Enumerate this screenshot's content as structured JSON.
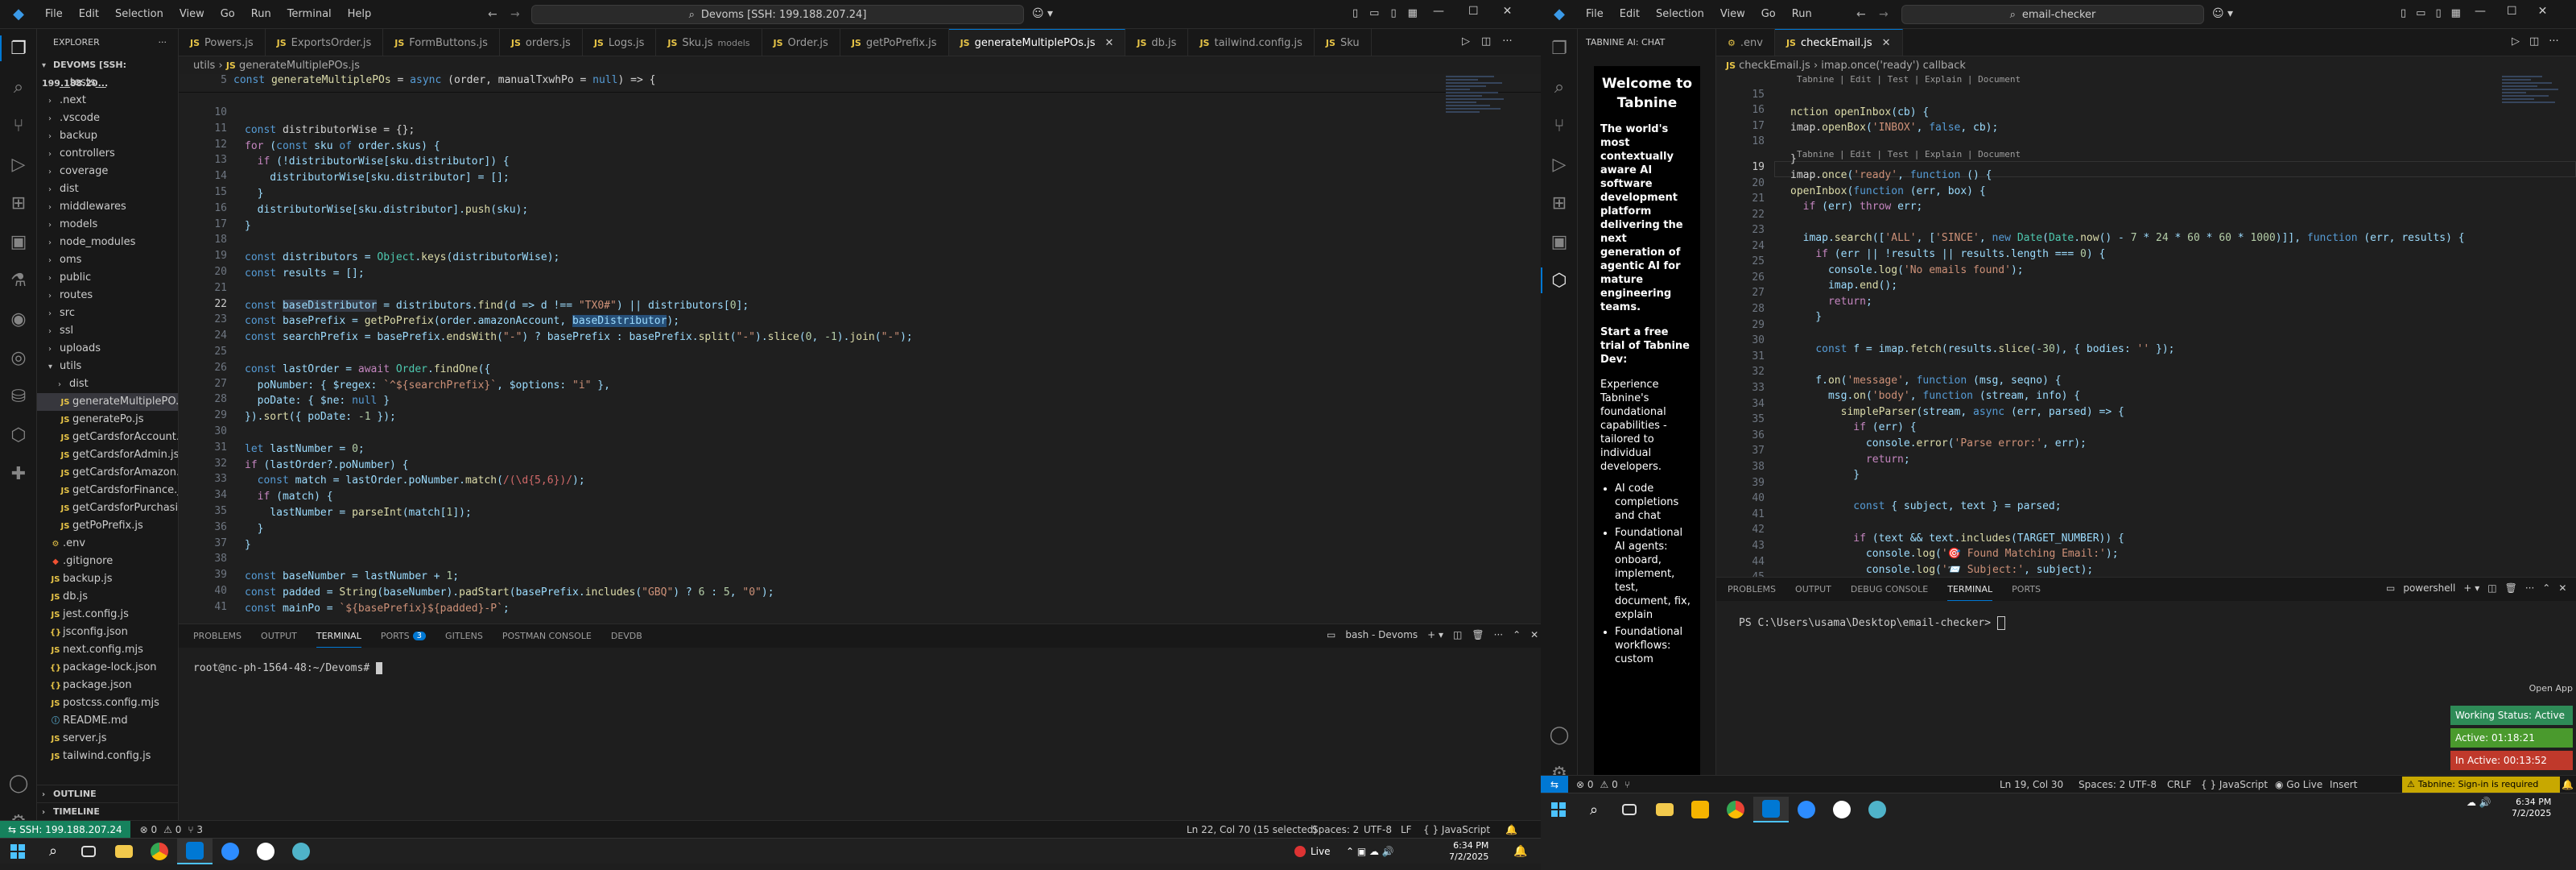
{
  "left": {
    "title_menu": [
      "File",
      "Edit",
      "Selection",
      "View",
      "Go",
      "Run",
      "Terminal",
      "Help"
    ],
    "command_center": "Devoms [SSH: 199.188.207.24]",
    "explorer_title": "EXPLORER",
    "root": "DEVOMS [SSH: 199.188.20...",
    "tree": [
      {
        "label": "__tests__",
        "kind": "folder"
      },
      {
        "label": ".next",
        "kind": "folder"
      },
      {
        "label": ".vscode",
        "kind": "folder"
      },
      {
        "label": "backup",
        "kind": "folder"
      },
      {
        "label": "controllers",
        "kind": "folder"
      },
      {
        "label": "coverage",
        "kind": "folder"
      },
      {
        "label": "dist",
        "kind": "folder"
      },
      {
        "label": "middlewares",
        "kind": "folder"
      },
      {
        "label": "models",
        "kind": "folder"
      },
      {
        "label": "node_modules",
        "kind": "folder"
      },
      {
        "label": "oms",
        "kind": "folder"
      },
      {
        "label": "public",
        "kind": "folder"
      },
      {
        "label": "routes",
        "kind": "folder"
      },
      {
        "label": "src",
        "kind": "folder"
      },
      {
        "label": "ssl",
        "kind": "folder"
      },
      {
        "label": "uploads",
        "kind": "folder"
      },
      {
        "label": "utils",
        "kind": "open"
      },
      {
        "label": "dist",
        "kind": "subfolder"
      },
      {
        "label": "generateMultiplePO...",
        "kind": "subjs",
        "selected": true
      },
      {
        "label": "generatePo.js",
        "kind": "subjs"
      },
      {
        "label": "getCardsforAccount.js",
        "kind": "subjs"
      },
      {
        "label": "getCardsforAdmin.js",
        "kind": "subjs"
      },
      {
        "label": "getCardsforAmazon.js",
        "kind": "subjs"
      },
      {
        "label": "getCardsforFinance.js",
        "kind": "subjs"
      },
      {
        "label": "getCardsforPurchasi...",
        "kind": "subjs"
      },
      {
        "label": "getPoPrefix.js",
        "kind": "subjs"
      },
      {
        "label": ".env",
        "kind": "env"
      },
      {
        "label": ".gitignore",
        "kind": "git"
      },
      {
        "label": "backup.js",
        "kind": "js"
      },
      {
        "label": "db.js",
        "kind": "js"
      },
      {
        "label": "jest.config.js",
        "kind": "js"
      },
      {
        "label": "jsconfig.json",
        "kind": "json"
      },
      {
        "label": "next.config.mjs",
        "kind": "js"
      },
      {
        "label": "package-lock.json",
        "kind": "json"
      },
      {
        "label": "package.json",
        "kind": "json"
      },
      {
        "label": "postcss.config.mjs",
        "kind": "js"
      },
      {
        "label": "README.md",
        "kind": "md"
      },
      {
        "label": "server.js",
        "kind": "js"
      },
      {
        "label": "tailwind.config.js",
        "kind": "js"
      }
    ],
    "outline": "OUTLINE",
    "timeline": "TIMELINE",
    "tabs": [
      {
        "label": "Powers.js",
        "active": false
      },
      {
        "label": "ExportsOrder.js",
        "active": false
      },
      {
        "label": "FormButtons.js",
        "active": false
      },
      {
        "label": "orders.js",
        "active": false
      },
      {
        "label": "Logs.js",
        "active": false
      },
      {
        "label": "Sku.js",
        "suffix": "models",
        "active": false
      },
      {
        "label": "Order.js",
        "active": false
      },
      {
        "label": "getPoPrefix.js",
        "active": false
      },
      {
        "label": "generateMultiplePOs.js",
        "active": true
      },
      {
        "label": "db.js",
        "active": false
      },
      {
        "label": "tailwind.config.js",
        "active": false
      },
      {
        "label": "Sku",
        "active": false
      }
    ],
    "breadcrumb": [
      "utils",
      "generateMultiplePOs.js"
    ],
    "sticky_line": "5",
    "panel_tabs": [
      "PROBLEMS",
      "OUTPUT",
      "TERMINAL",
      "PORTS",
      "GITLENS",
      "POSTMAN CONSOLE",
      "DEVDB"
    ],
    "ports_count": "3",
    "terminal_label": "bash - Devoms",
    "terminal_prompt": "root@nc-ph-1564-48:~/Devoms#",
    "status_remote": "SSH: 199.188.207.24",
    "status_errors": "0",
    "status_warnings": "0",
    "status_ports": "3",
    "status_position": "Ln 22, Col 70 (15 selected)",
    "status_spaces": "Spaces: 2",
    "status_encoding": "UTF-8",
    "status_eol": "LF",
    "status_lang": "JavaScript",
    "taskbar_live": "Live",
    "clock_time": "6:34 PM",
    "clock_date": "7/2/2025"
  },
  "right": {
    "title_menu": [
      "File",
      "Edit",
      "Selection",
      "View",
      "Go",
      "Run"
    ],
    "command_center": "email-checker",
    "tabnine_header": "TABNINE AI: CHAT",
    "tabnine_welcome": "Welcome to Tabnine",
    "tabnine_intro": "The world's most contextually aware AI software development platform delivering the next generation of agentic AI for mature engineering teams.",
    "tabnine_trial": "Start a free trial of Tabnine Dev:",
    "tabnine_exp": "Experience Tabnine's foundational capabilities - tailored to individual developers.",
    "tabnine_bullets": [
      "AI code completions and chat",
      "Foundational AI agents: onboard, implement, test, document, fix, explain",
      "Foundational workflows: custom"
    ],
    "tabs": [
      {
        "label": ".env",
        "active": false
      },
      {
        "label": "checkEmail.js",
        "active": true
      }
    ],
    "breadcrumb": [
      "checkEmail.js",
      "imap.once('ready') callback"
    ],
    "codelens": "Tabnine | Edit | Test | Explain | Document",
    "panel_tabs": [
      "PROBLEMS",
      "OUTPUT",
      "DEBUG CONSOLE",
      "TERMINAL",
      "PORTS"
    ],
    "terminal_label": "powershell",
    "terminal_prompt": "PS C:\\Users\\usama\\Desktop\\email-checker>",
    "open_app": "Open App",
    "work_status": "Working Status: Active",
    "active_time": "Active: 01:18:21",
    "inactive_time": "In Active: 00:13:52",
    "status_errors": "0",
    "status_warnings": "0",
    "status_position": "Ln 19, Col 30",
    "status_spaces": "Spaces: 2",
    "status_encoding": "UTF-8",
    "status_eol": "CRLF",
    "status_lang": "JavaScript",
    "status_golive": "Go Live",
    "status_insert": "Insert",
    "status_tabnine": "Tabnine: Sign-in is required",
    "clock_time": "6:34 PM",
    "clock_date": "7/2/2025"
  },
  "colors": {
    "accent": "#0078d4",
    "remote": "#16825d",
    "status_active": "#2e8b57",
    "status_time": "#4a9a2d",
    "status_inactive": "#c0392b",
    "tabnine_warn": "#c8a800"
  }
}
